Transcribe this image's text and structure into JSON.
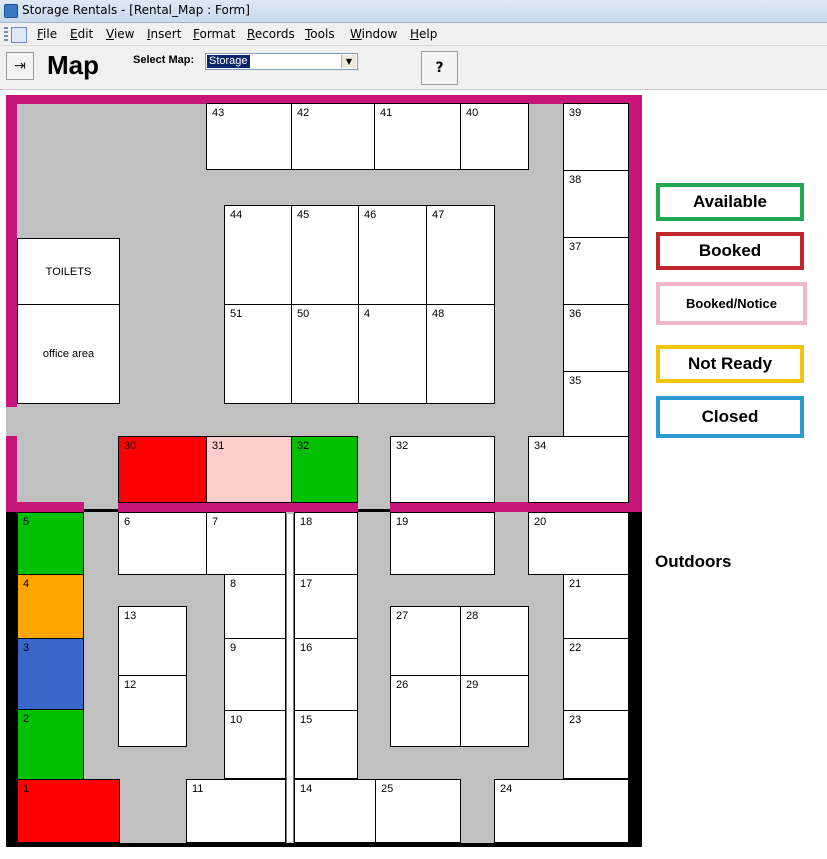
{
  "window": {
    "title": "Storage Rentals - [Rental_Map : Form]"
  },
  "menu": [
    "File",
    "Edit",
    "View",
    "Insert",
    "Format",
    "Records",
    "Tools",
    "Window",
    "Help"
  ],
  "toolbar": {
    "page_title": "Map",
    "select_label": "Select Map:",
    "select_value": "Storage",
    "help_label": "?"
  },
  "colors": {
    "available": "#22a852",
    "booked": "#c0282d",
    "booked_notice": "#f2b6cc",
    "not_ready": "#f1c40f",
    "closed": "#2b9bd0",
    "wall_indoor": "#c8157a",
    "wall_outdoor": "#000000",
    "floor": "#c0c0c0"
  },
  "legend": [
    {
      "label": "Available",
      "color": "#22a852"
    },
    {
      "label": "Booked",
      "color": "#c0282d"
    },
    {
      "label": "Booked/Notice",
      "color": "#f2b6cc"
    },
    {
      "label": "Not Ready",
      "color": "#f1c40f"
    },
    {
      "label": "Closed",
      "color": "#2b9bd0"
    }
  ],
  "rooms": {
    "toilets": "TOILETS",
    "office": "office area"
  },
  "outdoors_label": "Outdoors",
  "units": [
    {
      "id": "43",
      "status": "white"
    },
    {
      "id": "42",
      "status": "white"
    },
    {
      "id": "41",
      "status": "white"
    },
    {
      "id": "40",
      "status": "white"
    },
    {
      "id": "39",
      "status": "white"
    },
    {
      "id": "38",
      "status": "white"
    },
    {
      "id": "37",
      "status": "white"
    },
    {
      "id": "36",
      "status": "white"
    },
    {
      "id": "35",
      "status": "white"
    },
    {
      "id": "44",
      "status": "white"
    },
    {
      "id": "45",
      "status": "white"
    },
    {
      "id": "46",
      "status": "white"
    },
    {
      "id": "47",
      "status": "white"
    },
    {
      "id": "51",
      "status": "white"
    },
    {
      "id": "50",
      "status": "white"
    },
    {
      "id": "4",
      "status": "white"
    },
    {
      "id": "48",
      "status": "white"
    },
    {
      "id": "30",
      "status": "booked"
    },
    {
      "id": "31",
      "status": "booked_notice"
    },
    {
      "id": "32",
      "status": "available"
    },
    {
      "id": "32",
      "status": "white"
    },
    {
      "id": "34",
      "status": "white"
    },
    {
      "id": "5",
      "status": "available"
    },
    {
      "id": "4",
      "status": "orange"
    },
    {
      "id": "3",
      "status": "blue"
    },
    {
      "id": "2",
      "status": "available"
    },
    {
      "id": "1",
      "status": "booked"
    },
    {
      "id": "6",
      "status": "white"
    },
    {
      "id": "7",
      "status": "white"
    },
    {
      "id": "8",
      "status": "white"
    },
    {
      "id": "9",
      "status": "white"
    },
    {
      "id": "10",
      "status": "white"
    },
    {
      "id": "11",
      "status": "white"
    },
    {
      "id": "13",
      "status": "white"
    },
    {
      "id": "12",
      "status": "white"
    },
    {
      "id": "18",
      "status": "white"
    },
    {
      "id": "17",
      "status": "white"
    },
    {
      "id": "16",
      "status": "white"
    },
    {
      "id": "15",
      "status": "white"
    },
    {
      "id": "14",
      "status": "white"
    },
    {
      "id": "19",
      "status": "white"
    },
    {
      "id": "27",
      "status": "white"
    },
    {
      "id": "28",
      "status": "white"
    },
    {
      "id": "26",
      "status": "white"
    },
    {
      "id": "29",
      "status": "white"
    },
    {
      "id": "25",
      "status": "white"
    },
    {
      "id": "20",
      "status": "white"
    },
    {
      "id": "21",
      "status": "white"
    },
    {
      "id": "22",
      "status": "white"
    },
    {
      "id": "23",
      "status": "white"
    },
    {
      "id": "24",
      "status": "white"
    }
  ]
}
